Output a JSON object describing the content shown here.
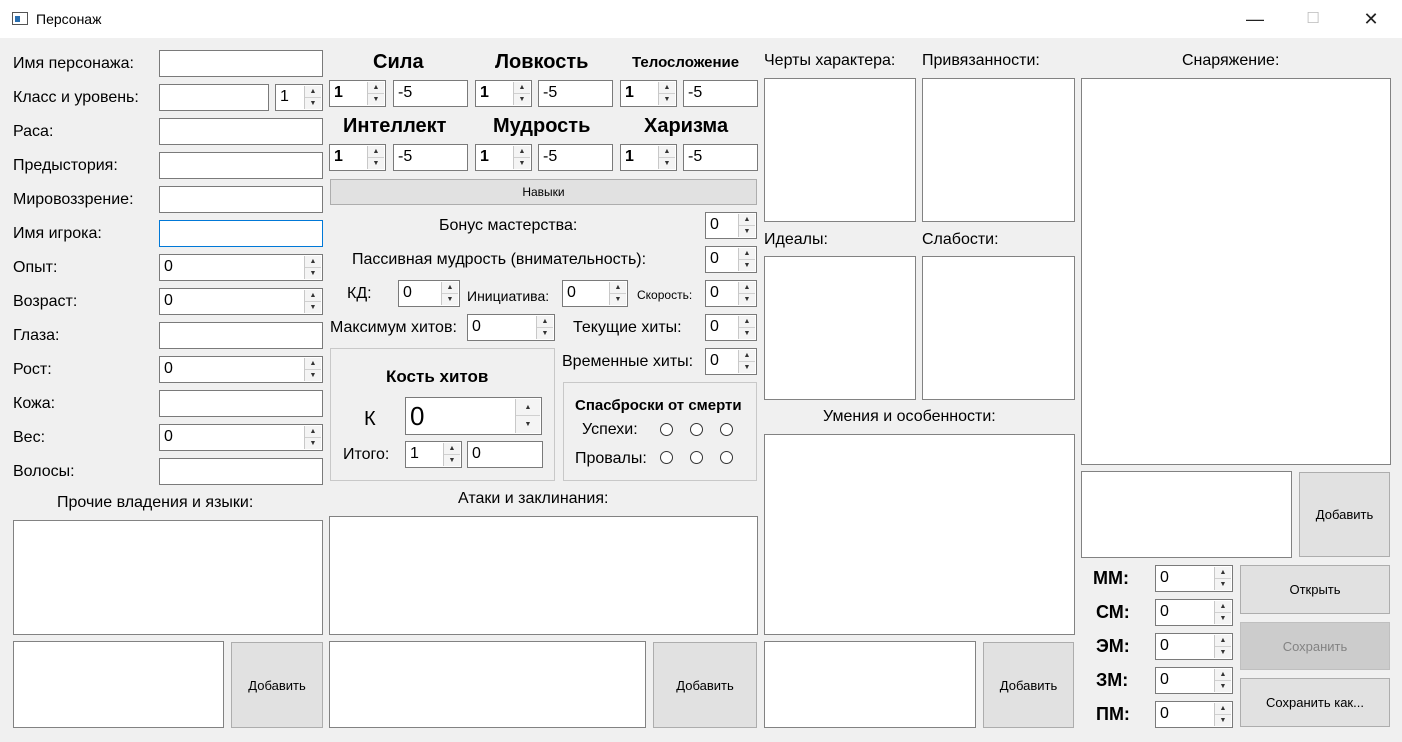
{
  "window": {
    "title": "Персонаж",
    "minimize": "—",
    "maximize": "☐",
    "close": "✕"
  },
  "personal": {
    "name_label": "Имя персонажа:",
    "class_label": "Класс и уровень:",
    "level_value": "1",
    "race_label": "Раса:",
    "background_label": "Предыстория:",
    "alignment_label": "Мировоззрение:",
    "player_label": "Имя игрока:",
    "exp_label": "Опыт:",
    "exp_value": "0",
    "age_label": "Возраст:",
    "age_value": "0",
    "eyes_label": "Глаза:",
    "height_label": "Рост:",
    "height_value": "0",
    "skin_label": "Кожа:",
    "weight_label": "Вес:",
    "weight_value": "0",
    "hair_label": "Волосы:"
  },
  "abilities": [
    {
      "name": "Сила",
      "value": "1",
      "mod": "-5"
    },
    {
      "name": "Ловкость",
      "value": "1",
      "mod": "-5"
    },
    {
      "name": "Телосложение",
      "value": "1",
      "mod": "-5"
    },
    {
      "name": "Интеллект",
      "value": "1",
      "mod": "-5"
    },
    {
      "name": "Мудрость",
      "value": "1",
      "mod": "-5"
    },
    {
      "name": "Харизма",
      "value": "1",
      "mod": "-5"
    }
  ],
  "skills_button": "Навыки",
  "combat": {
    "proficiency_label": "Бонус мастерства:",
    "proficiency_value": "0",
    "passive_label": "Пассивная мудрость (внимательность):",
    "passive_value": "0",
    "ac_label": "КД:",
    "ac_value": "0",
    "initiative_label": "Инициатива:",
    "initiative_value": "0",
    "speed_label": "Скорость:",
    "speed_value": "0",
    "maxhp_label": "Максимум хитов:",
    "maxhp_value": "0",
    "curhp_label": "Текущие хиты:",
    "curhp_value": "0",
    "temphp_label": "Временные хиты:",
    "temphp_value": "0"
  },
  "hit_dice": {
    "title": "Кость хитов",
    "k_label": "К",
    "die_value": "0",
    "total_label": "Итого:",
    "count_value": "1",
    "total_value": "0"
  },
  "death_saves": {
    "title": "Спасброски от смерти",
    "success_label": "Успехи:",
    "fail_label": "Провалы:"
  },
  "proficiencies": {
    "title": "Прочие владения и языки:",
    "add_button": "Добавить"
  },
  "attacks": {
    "title": "Атаки и заклинания:",
    "add_button": "Добавить"
  },
  "traits": {
    "personality_label": "Черты характера:",
    "bonds_label": "Привязанности:",
    "ideals_label": "Идеалы:",
    "flaws_label": "Слабости:"
  },
  "features": {
    "title": "Умения и особенности:",
    "add_button": "Добавить"
  },
  "equipment": {
    "title": "Снаряжение:",
    "add_button": "Добавить"
  },
  "coins": [
    {
      "label": "ММ:",
      "value": "0"
    },
    {
      "label": "СМ:",
      "value": "0"
    },
    {
      "label": "ЭМ:",
      "value": "0"
    },
    {
      "label": "ЗМ:",
      "value": "0"
    },
    {
      "label": "ПМ:",
      "value": "0"
    }
  ],
  "file_buttons": {
    "open": "Открыть",
    "save": "Сохранить",
    "save_as": "Сохранить как..."
  }
}
